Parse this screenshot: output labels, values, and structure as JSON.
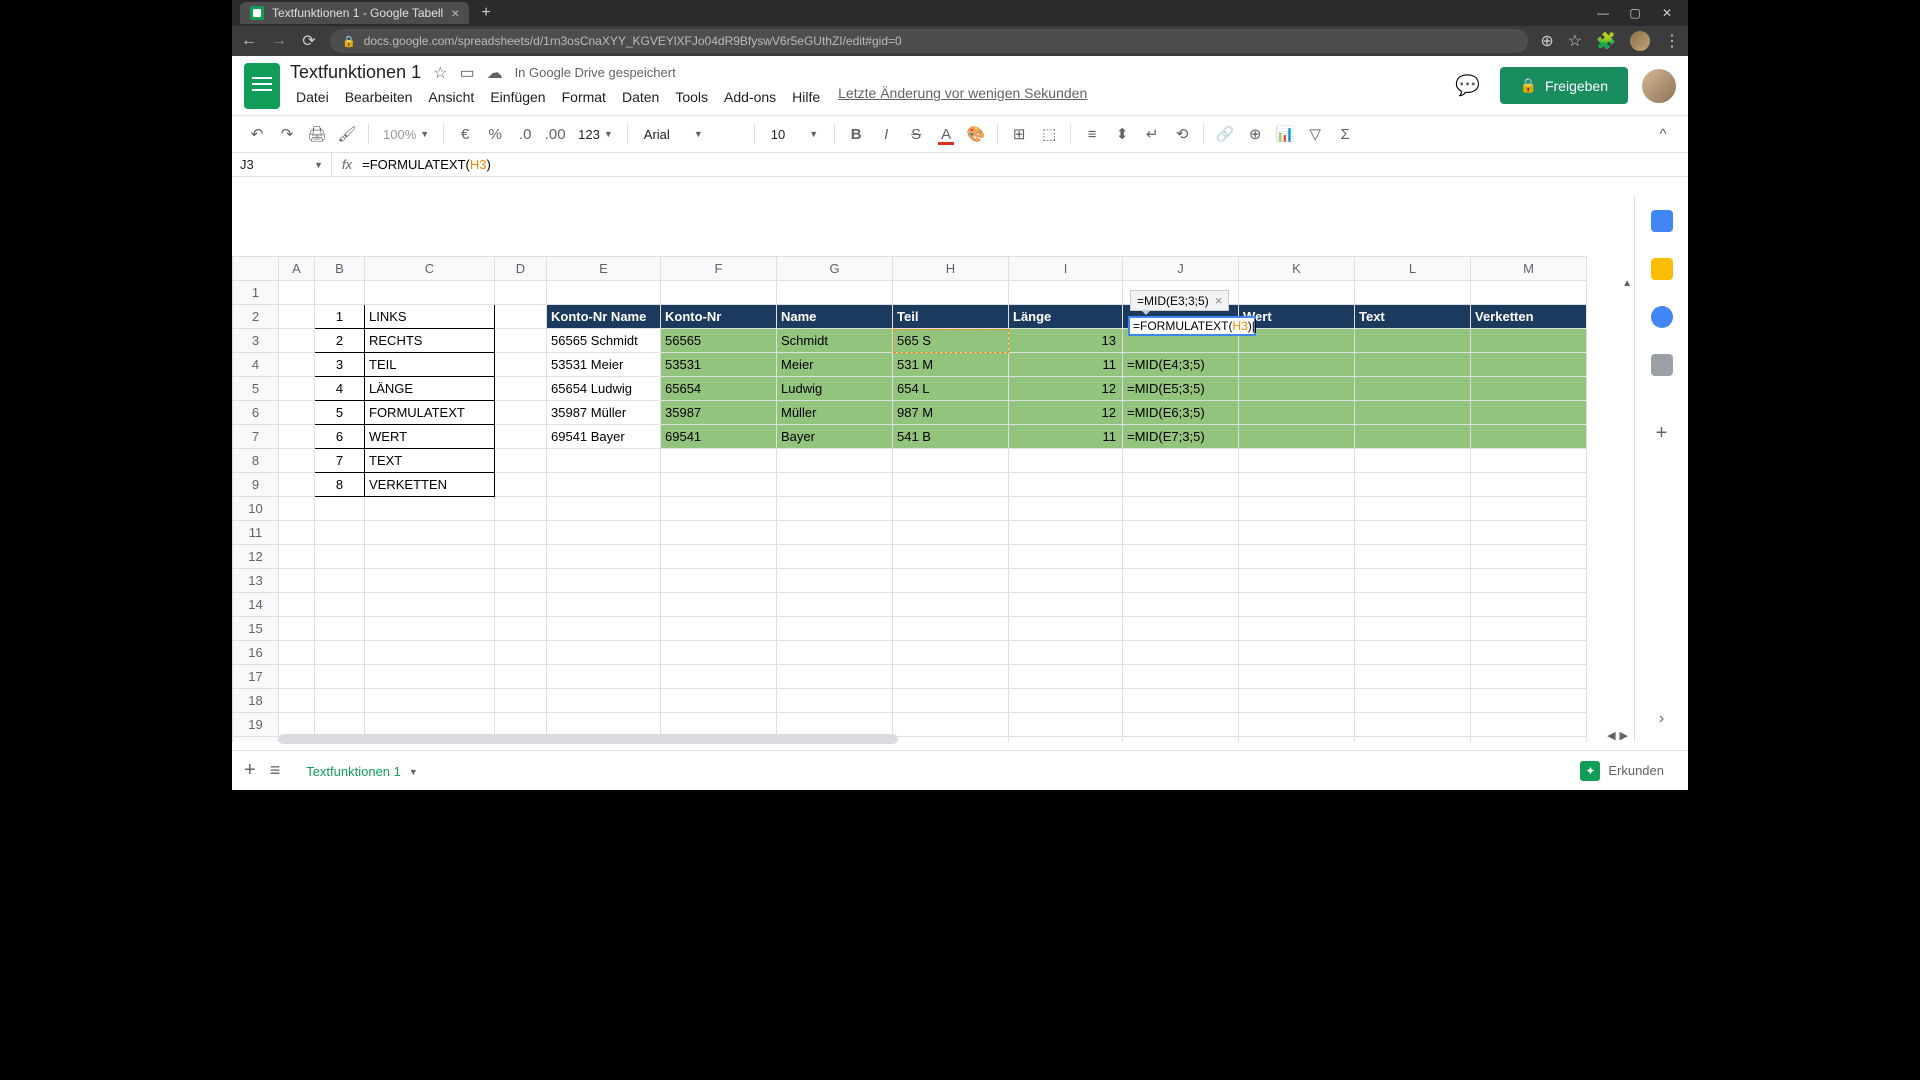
{
  "browser": {
    "tab_title": "Textfunktionen 1 - Google Tabell",
    "url": "docs.google.com/spreadsheets/d/1rn3osCnaXYY_KGVEYlXFJo04dR9BfyswV6r5eGUthZI/edit#gid=0"
  },
  "doc": {
    "title": "Textfunktionen 1",
    "drive_status": "In Google Drive gespeichert",
    "menus": [
      "Datei",
      "Bearbeiten",
      "Ansicht",
      "Einfügen",
      "Format",
      "Daten",
      "Tools",
      "Add-ons",
      "Hilfe"
    ],
    "last_edit": "Letzte Änderung vor wenigen Sekunden",
    "share_label": "Freigeben"
  },
  "toolbar": {
    "zoom": "100%",
    "font": "Arial",
    "font_size": "10",
    "number_format": "123"
  },
  "name_box": "J3",
  "formula_bar": {
    "prefix": "=FORMULATEXT(",
    "ref": "H3",
    "suffix": ")"
  },
  "columns": [
    "A",
    "B",
    "C",
    "D",
    "E",
    "F",
    "G",
    "H",
    "I",
    "J",
    "K",
    "L",
    "M"
  ],
  "row_count": 21,
  "func_list": [
    {
      "n": "1",
      "name": "LINKS"
    },
    {
      "n": "2",
      "name": "RECHTS"
    },
    {
      "n": "3",
      "name": "TEIL"
    },
    {
      "n": "4",
      "name": "LÄNGE"
    },
    {
      "n": "5",
      "name": "FORMULATEXT"
    },
    {
      "n": "6",
      "name": "WERT"
    },
    {
      "n": "7",
      "name": "TEXT"
    },
    {
      "n": "8",
      "name": "VERKETTEN"
    }
  ],
  "table_headers": {
    "E": "Konto-Nr Name",
    "F": "Konto-Nr",
    "G": "Name",
    "H": "Teil",
    "I": "Länge",
    "K": "Wert",
    "L": "Text",
    "M": "Verketten"
  },
  "table_rows": [
    {
      "E": "56565 Schmidt",
      "F": "56565",
      "G": "Schmidt",
      "H": "565 S",
      "I": "13",
      "J": ""
    },
    {
      "E": "53531 Meier",
      "F": "53531",
      "G": "Meier",
      "H": "531 M",
      "I": "11",
      "J": "=MID(E4;3;5)"
    },
    {
      "E": "65654 Ludwig",
      "F": "65654",
      "G": "Ludwig",
      "H": "654 L",
      "I": "12",
      "J": "=MID(E5;3;5)"
    },
    {
      "E": "35987 Müller",
      "F": "35987",
      "G": "Müller",
      "H": "987 M",
      "I": "12",
      "J": "=MID(E6;3;5)"
    },
    {
      "E": "69541 Bayer",
      "F": "69541",
      "G": "Bayer",
      "H": "541 B",
      "I": "11",
      "J": "=MID(E7;3;5)"
    }
  ],
  "editor": {
    "preview": "=MID(E3;3;5)",
    "text_prefix": "=FORMULATEXT(",
    "text_ref": "H3",
    "text_suffix": ")"
  },
  "sheet_tab": "Textfunktionen 1",
  "explore": "Erkunden"
}
